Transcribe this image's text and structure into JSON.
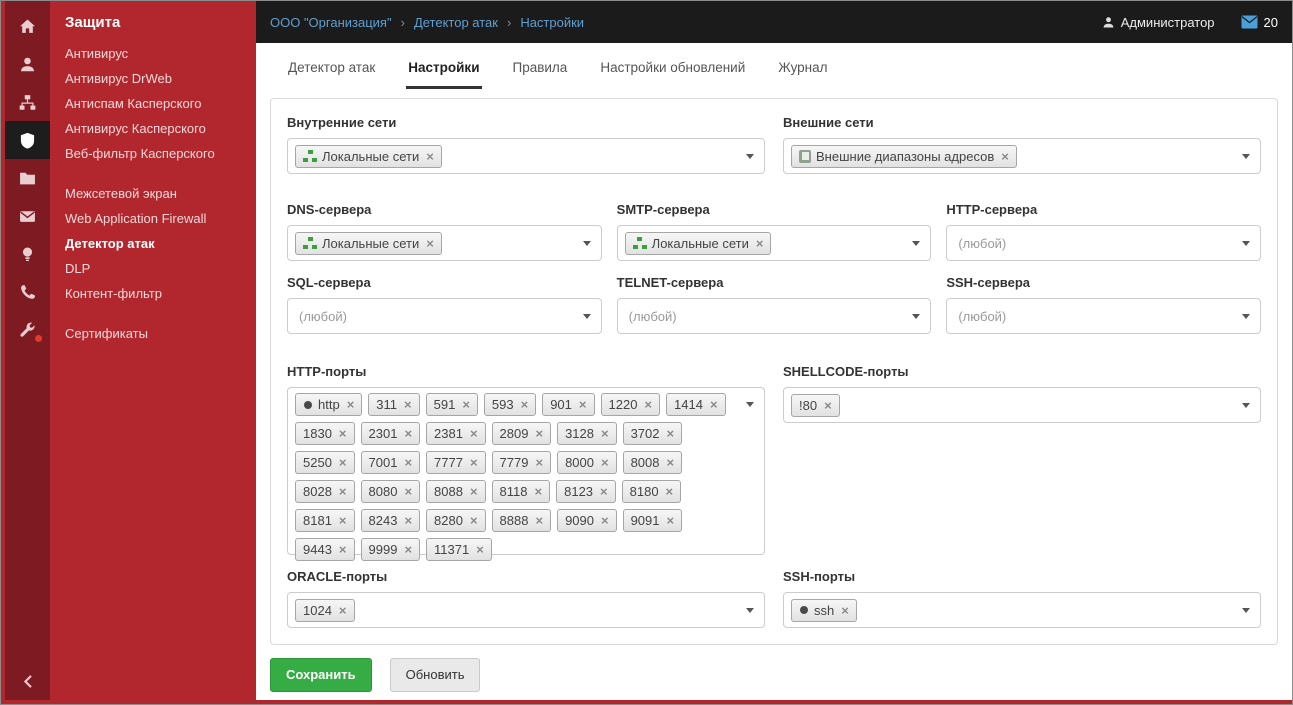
{
  "ui": {
    "tag_close": "×",
    "breadcrumb_separator": "›"
  },
  "colors": {
    "sidebar_menu": "#b2272e",
    "sidebar_strip": "#7e1a22",
    "active_strip_cell": "#1d1d1d",
    "topbar": "#1b1b1b",
    "breadcrumb_link": "#5f9fd2",
    "accent_green": "#35ad44",
    "tag_icon_network": "#3c9e3c",
    "tag_icon_book": "#8fa08f",
    "badge_red": "#e23b2e"
  },
  "icons": {
    "strip": [
      "home-icon",
      "user-icon",
      "network-icon",
      "shield-icon",
      "folder-icon",
      "mail-icon",
      "bulb-icon",
      "phone-icon",
      "wrench-icon"
    ],
    "collapse": "chevron-left-icon",
    "topbar": [
      "user-icon",
      "mail-icon"
    ],
    "tag_icons": {
      "network": "green sitemap",
      "book": "address book",
      "service": "dark dot"
    }
  },
  "sidebar": {
    "header": "Защита",
    "items": [
      {
        "label": "Антивирус"
      },
      {
        "label": "Антивирус DrWeb"
      },
      {
        "label": "Антиспам Касперского"
      },
      {
        "label": "Антивирус Касперского"
      },
      {
        "label": "Веб-фильтр Касперского"
      },
      {
        "label": "Межсетевой экран",
        "gap": true
      },
      {
        "label": "Web Application Firewall"
      },
      {
        "label": "Детектор атак",
        "active": true
      },
      {
        "label": "DLP"
      },
      {
        "label": "Контент-фильтр"
      },
      {
        "label": "Сертификаты",
        "gap": true
      }
    ]
  },
  "topbar": {
    "breadcrumb": [
      {
        "label": "ООО \"Организация\""
      },
      {
        "label": "Детектор атак"
      },
      {
        "label": "Настройки"
      }
    ],
    "user": "Администратор",
    "mail_count": "20"
  },
  "tabs": [
    {
      "label": "Детектор атак"
    },
    {
      "label": "Настройки",
      "active": true
    },
    {
      "label": "Правила"
    },
    {
      "label": "Настройки обновлений"
    },
    {
      "label": "Журнал"
    }
  ],
  "form": {
    "internal_networks": {
      "label": "Внутренние сети",
      "tags": [
        {
          "text": "Локальные сети",
          "icon": "network"
        }
      ]
    },
    "external_networks": {
      "label": "Внешние сети",
      "tags": [
        {
          "text": "Внешние диапазоны адресов",
          "icon": "book"
        }
      ]
    },
    "dns_servers": {
      "label": "DNS-сервера",
      "tags": [
        {
          "text": "Локальные сети",
          "icon": "network"
        }
      ]
    },
    "smtp_servers": {
      "label": "SMTP-сервера",
      "tags": [
        {
          "text": "Локальные сети",
          "icon": "network"
        }
      ]
    },
    "http_servers": {
      "label": "HTTP-сервера",
      "placeholder": "(любой)"
    },
    "sql_servers": {
      "label": "SQL-сервера",
      "placeholder": "(любой)"
    },
    "telnet_servers": {
      "label": "TELNET-сервера",
      "placeholder": "(любой)"
    },
    "ssh_servers": {
      "label": "SSH-сервера",
      "placeholder": "(любой)"
    },
    "http_ports": {
      "label": "HTTP-порты",
      "tags": [
        {
          "text": "http",
          "icon": "service"
        },
        {
          "text": "311"
        },
        {
          "text": "591"
        },
        {
          "text": "593"
        },
        {
          "text": "901"
        },
        {
          "text": "1220"
        },
        {
          "text": "1414"
        },
        {
          "text": "1830"
        },
        {
          "text": "2301"
        },
        {
          "text": "2381"
        },
        {
          "text": "2809"
        },
        {
          "text": "3128"
        },
        {
          "text": "3702"
        },
        {
          "text": "5250"
        },
        {
          "text": "7001"
        },
        {
          "text": "7777"
        },
        {
          "text": "7779"
        },
        {
          "text": "8000"
        },
        {
          "text": "8008"
        },
        {
          "text": "8028"
        },
        {
          "text": "8080"
        },
        {
          "text": "8088"
        },
        {
          "text": "8118"
        },
        {
          "text": "8123"
        },
        {
          "text": "8180"
        },
        {
          "text": "8181"
        },
        {
          "text": "8243"
        },
        {
          "text": "8280"
        },
        {
          "text": "8888"
        },
        {
          "text": "9090"
        },
        {
          "text": "9091"
        },
        {
          "text": "9443"
        },
        {
          "text": "9999"
        },
        {
          "text": "11371"
        }
      ]
    },
    "shellcode_ports": {
      "label": "SHELLCODE-порты",
      "tags": [
        {
          "text": "!80"
        }
      ]
    },
    "oracle_ports": {
      "label": "ORACLE-порты",
      "tags": [
        {
          "text": "1024"
        }
      ]
    },
    "ssh_ports": {
      "label": "SSH-порты",
      "tags": [
        {
          "text": "ssh",
          "icon": "service"
        }
      ]
    }
  },
  "actions": {
    "save": "Сохранить",
    "refresh": "Обновить"
  }
}
